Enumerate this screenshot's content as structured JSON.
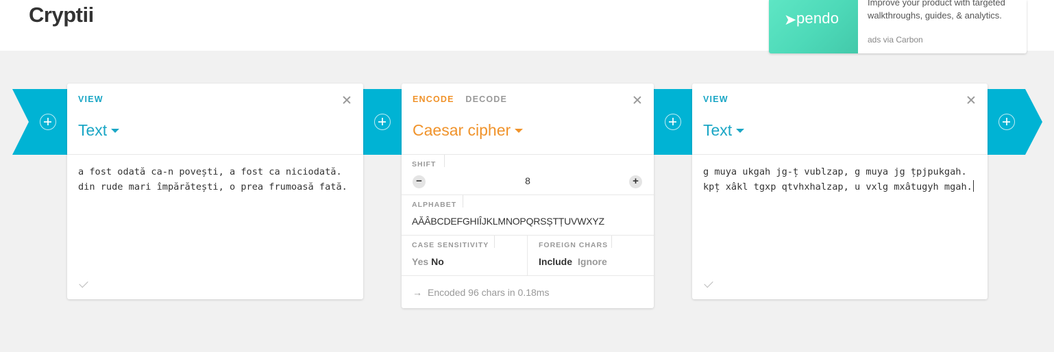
{
  "app": {
    "title": "Cryptii"
  },
  "ad": {
    "brand": "pendo",
    "text": "Improve your product with targeted walkthroughs, guides, & analytics.",
    "via": "ads via Carbon",
    "color": "#50deba"
  },
  "colors": {
    "band": "#00b3d4",
    "view_accent": "#1aa6c5",
    "encoder_accent": "#f0932b"
  },
  "left_viewer": {
    "tab_label": "VIEW",
    "title": "Text",
    "content": "a fost odată ca-n povești, a fost ca niciodată. din rude mari împărătești, o prea frumoasă fată."
  },
  "encoder": {
    "tabs": [
      "ENCODE",
      "DECODE"
    ],
    "active_tab": "ENCODE",
    "title": "Caesar cipher",
    "shift": {
      "label": "SHIFT",
      "value": "8",
      "minus": "−",
      "plus": "+"
    },
    "alphabet": {
      "label": "ALPHABET",
      "value": "AĂÂBCDEFGHIÎJKLMNOPQRSȘTȚUVWXYZ"
    },
    "case_sensitivity": {
      "label": "CASE SENSITIVITY",
      "options": [
        "Yes",
        "No"
      ],
      "selected": "No"
    },
    "foreign_chars": {
      "label": "FOREIGN CHARS",
      "options": [
        "Include",
        "Ignore"
      ],
      "selected": "Include"
    },
    "status": "Encoded 96 chars in 0.18ms"
  },
  "right_viewer": {
    "tab_label": "VIEW",
    "title": "Text",
    "content": "g muya ukgah jg-ț vublzap, g muya jg țpjpukgah. kpț xâkl tgxp qtvhxhalzap, u vxlg mxâtugyh mgah."
  }
}
